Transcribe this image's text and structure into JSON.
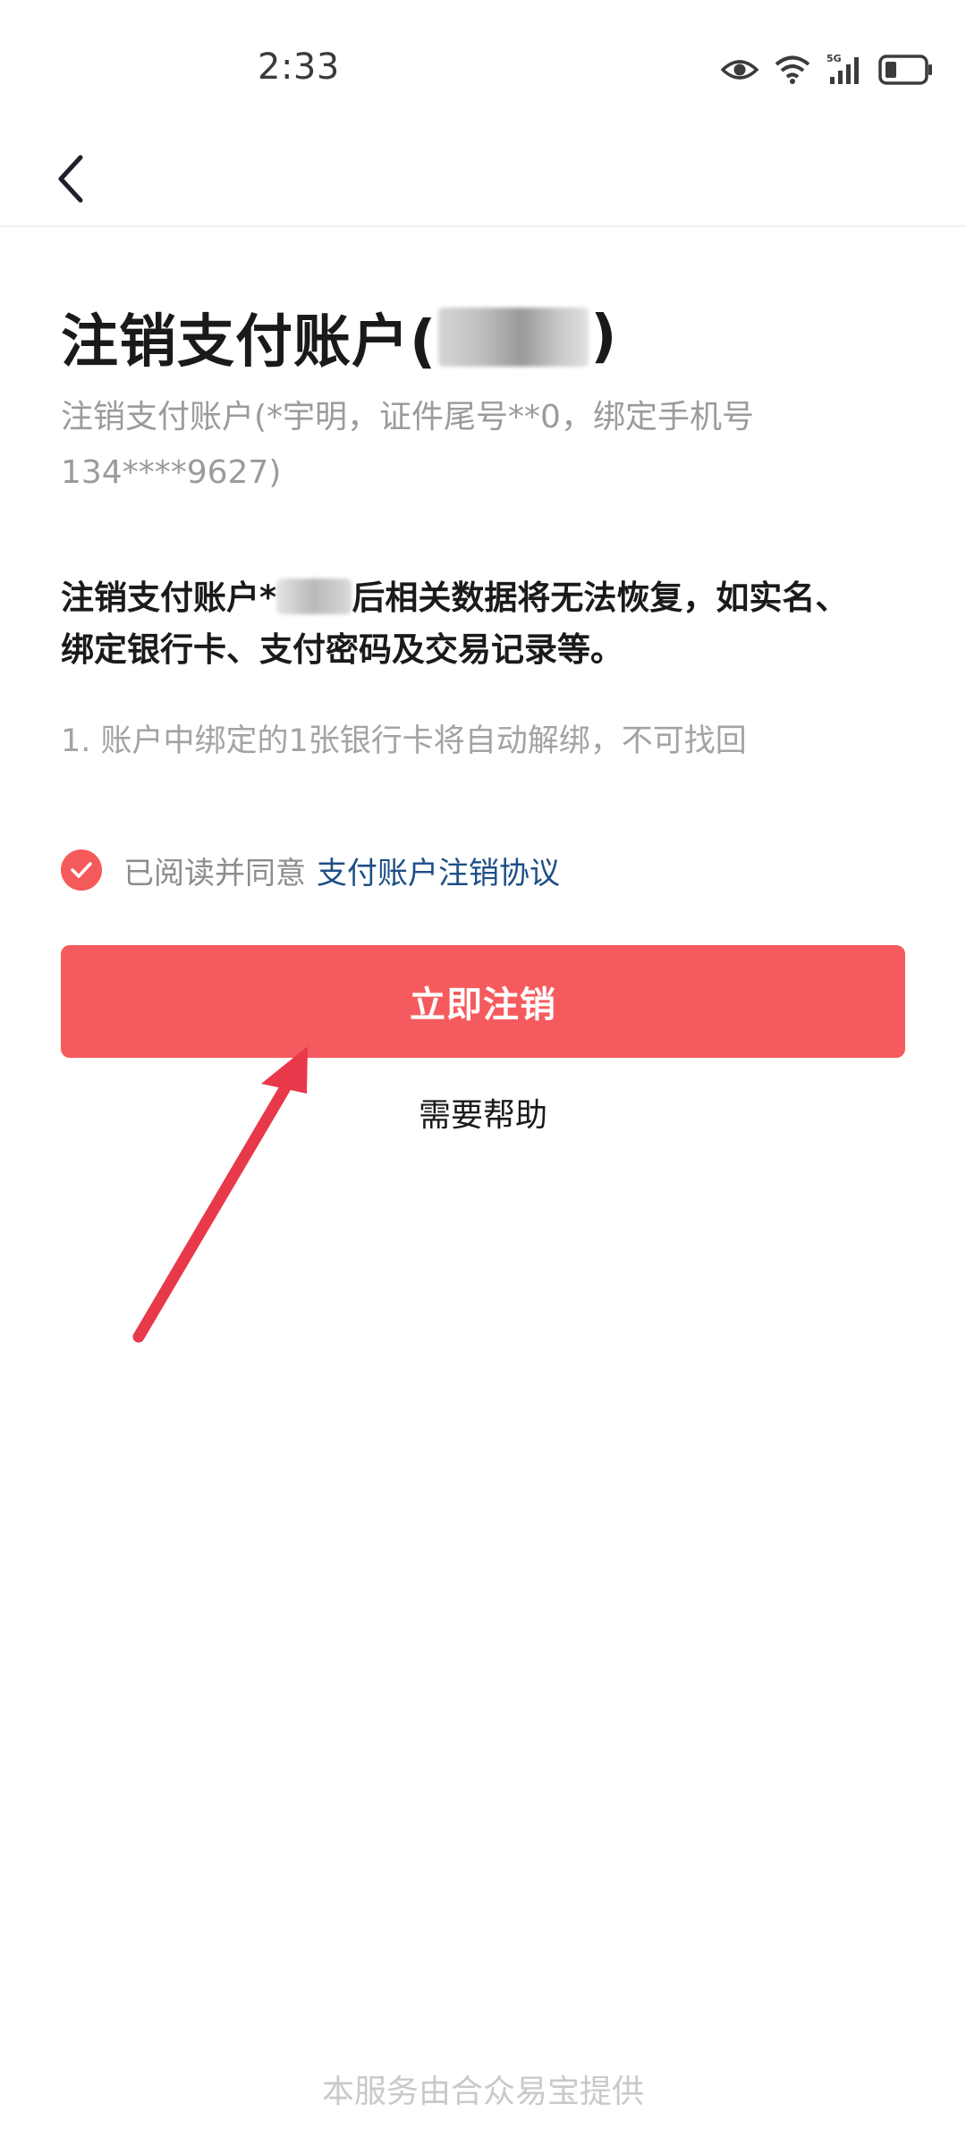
{
  "status_bar": {
    "time": "2:33",
    "network_label": "5G",
    "icons": [
      "eye-icon",
      "wifi-icon",
      "cellular-signal-icon",
      "battery-icon"
    ]
  },
  "nav": {
    "back_icon": "chevron-left-icon"
  },
  "content": {
    "title_prefix": "注销支付账户(",
    "title_suffix": ")",
    "subtitle": "注销支付账户(*宇明，证件尾号**0，绑定手机号134****9627)",
    "warning_prefix": "注销支付账户*",
    "warning_suffix": "后相关数据将无法恢复，如实名、绑定银行卡、支付密码及交易记录等。",
    "detail_item": "1. 账户中绑定的1张银行卡将自动解绑，不可找回",
    "agree_text": "已阅读并同意",
    "agree_link": "支付账户注销协议",
    "agree_checked": true,
    "primary_button": "立即注销",
    "help_link": "需要帮助"
  },
  "footer": {
    "text": "本服务由合众易宝提供"
  },
  "colors": {
    "accent": "#f55b5e",
    "link": "#1d4f86",
    "annotation_arrow": "#e8394a",
    "muted_text": "#9b9b9b"
  }
}
